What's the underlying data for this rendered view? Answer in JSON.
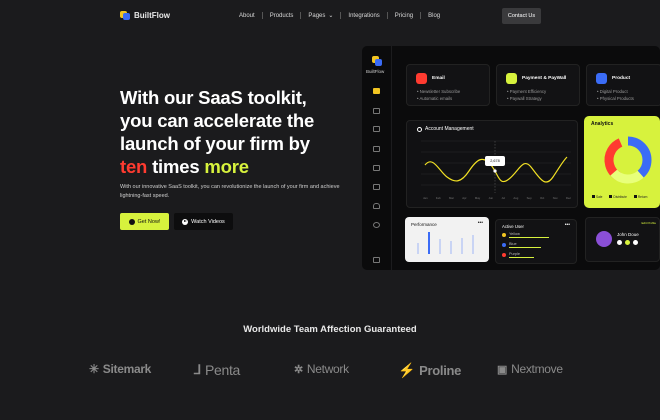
{
  "nav": {
    "brand": "BuiltFlow",
    "items": [
      {
        "label": "About"
      },
      {
        "label": "Products"
      },
      {
        "label": "Pages"
      },
      {
        "label": "Integrations"
      },
      {
        "label": "Pricing"
      },
      {
        "label": "Blog"
      }
    ],
    "contact": "Contact Us"
  },
  "hero": {
    "line1": "With our SaaS toolkit,",
    "line2": "you can accelerate the",
    "line3": "launch of your firm by",
    "highlight_red": "ten",
    "middle": " times ",
    "highlight_lime": "more",
    "description": "With our innovative SaaS toolkit, you can revolutionize the launch of your firm and achieve lightning-fast speed.",
    "primary_button": "Get Now!",
    "secondary_button": "Watch Videos"
  },
  "dashboard": {
    "brand": "BuiltFlow",
    "cards": [
      {
        "title": "Email",
        "lines": [
          "• Newsletter Subscribe",
          "• Automatic emails"
        ],
        "color": "#ff3b30"
      },
      {
        "title": "Payment & PayWall",
        "lines": [
          "• Payment Efficiency",
          "• Paywall Strategy"
        ],
        "color": "#d7f23d"
      },
      {
        "title": "Product",
        "lines": [
          "• Digital Product",
          "• Physical Products"
        ],
        "color": "#3b6cf6"
      }
    ],
    "account_management": {
      "title": "Account Management",
      "tooltip": "2,678",
      "months": [
        "Jan",
        "Feb",
        "Mar",
        "Apr",
        "May",
        "Jun",
        "Jul",
        "Aug",
        "Sep",
        "Oct",
        "Nov",
        "Dec"
      ]
    },
    "analytics": {
      "title": "Analytics",
      "legend": [
        "Sale",
        "Distribute",
        "Return"
      ]
    },
    "performance": {
      "title": "Performance",
      "menu": "•••"
    },
    "active_user": {
      "title": "Active User",
      "menu": "•••",
      "users": [
        "Yellow",
        "Blue",
        "Purple"
      ]
    },
    "profile": {
      "name": "John Doue",
      "edit": "Edit Profile"
    }
  },
  "logos": {
    "title": "Worldwide Team Affection Guaranteed",
    "items": [
      "Sitemark",
      "Penta",
      "Network",
      "Proline",
      "Nextmove"
    ]
  },
  "colors": {
    "background": "#1b1b1d",
    "accent_lime": "#d7f23d",
    "accent_red": "#ff3b30",
    "accent_blue": "#3b6cf6"
  }
}
